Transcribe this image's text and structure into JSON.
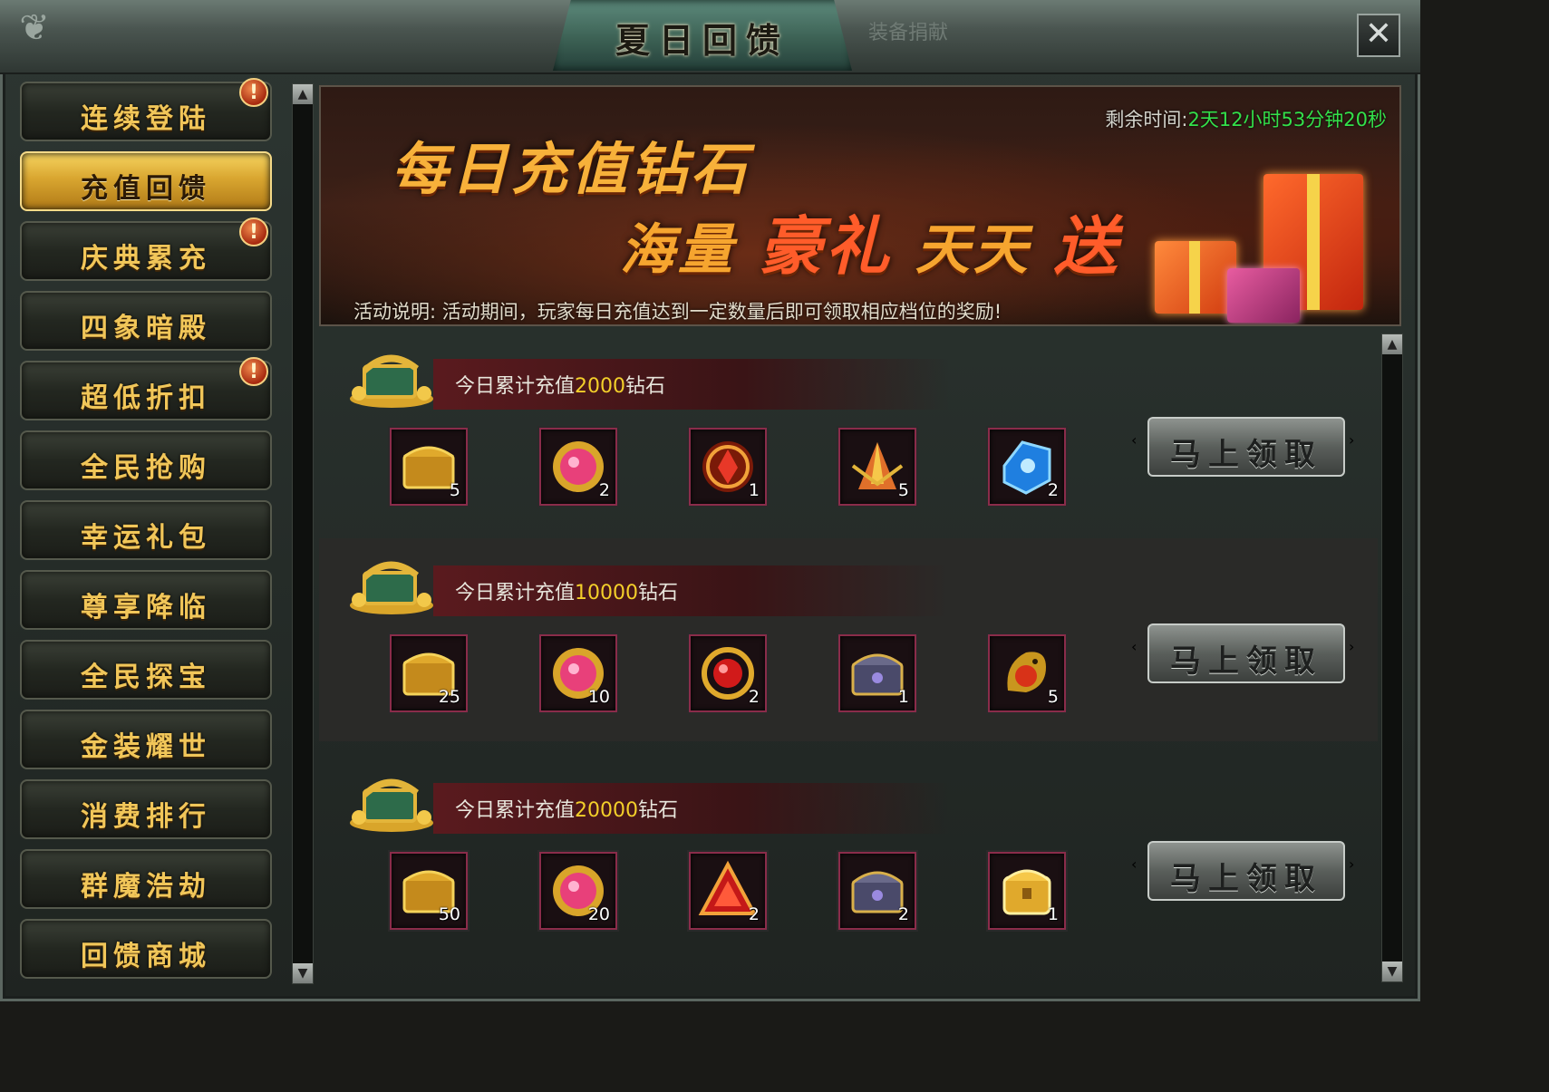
{
  "window": {
    "title": "夏日回馈",
    "tab2": "装备捐献",
    "close_symbol": "✕"
  },
  "sidebar": {
    "items": [
      {
        "label": "连续登陆",
        "badge": "!"
      },
      {
        "label": "充值回馈",
        "active": true
      },
      {
        "label": "庆典累充",
        "badge": "!"
      },
      {
        "label": "四象暗殿"
      },
      {
        "label": "超低折扣",
        "badge": "!"
      },
      {
        "label": "全民抢购"
      },
      {
        "label": "幸运礼包"
      },
      {
        "label": "尊享降临"
      },
      {
        "label": "全民探宝"
      },
      {
        "label": "金装耀世"
      },
      {
        "label": "消费排行"
      },
      {
        "label": "群魔浩劫"
      },
      {
        "label": "回馈商城"
      }
    ]
  },
  "banner": {
    "line1": "每日充值钻石",
    "line2_a": "海量",
    "line2_b": "豪礼",
    "line2_c": "天天",
    "line2_d": "送",
    "remain_label": "剩余时间:",
    "remain_value": "2天12小时53分钟20秒",
    "desc_label": "活动说明:",
    "desc_text": "活动期间，玩家每日充值达到一定数量后即可领取相应档位的奖励!"
  },
  "tiers": [
    {
      "prefix": "今日累计充值",
      "amount": "2000",
      "suffix": "钻石",
      "claim": "马上领取",
      "items": [
        {
          "icon": "gold-chest-icon",
          "count": "5"
        },
        {
          "icon": "pink-gem-icon",
          "count": "2"
        },
        {
          "icon": "red-crystal-orb-icon",
          "count": "1"
        },
        {
          "icon": "feather-fan-icon",
          "count": "5"
        },
        {
          "icon": "blue-gem-icon",
          "count": "2"
        }
      ]
    },
    {
      "prefix": "今日累计充值",
      "amount": "10000",
      "suffix": "钻石",
      "claim": "马上领取",
      "items": [
        {
          "icon": "gold-chest-icon",
          "count": "25"
        },
        {
          "icon": "pink-gem-icon",
          "count": "10"
        },
        {
          "icon": "red-ring-icon",
          "count": "2"
        },
        {
          "icon": "silver-chest-icon",
          "count": "1"
        },
        {
          "icon": "dragon-icon",
          "count": "5"
        }
      ]
    },
    {
      "prefix": "今日累计充值",
      "amount": "20000",
      "suffix": "钻石",
      "claim": "马上领取",
      "items": [
        {
          "icon": "gold-chest-icon",
          "count": "50"
        },
        {
          "icon": "pink-gem-icon",
          "count": "20"
        },
        {
          "icon": "red-triangle-icon",
          "count": "2"
        },
        {
          "icon": "silver-chest-icon",
          "count": "2"
        },
        {
          "icon": "golden-box-icon",
          "count": "1"
        }
      ]
    }
  ]
}
